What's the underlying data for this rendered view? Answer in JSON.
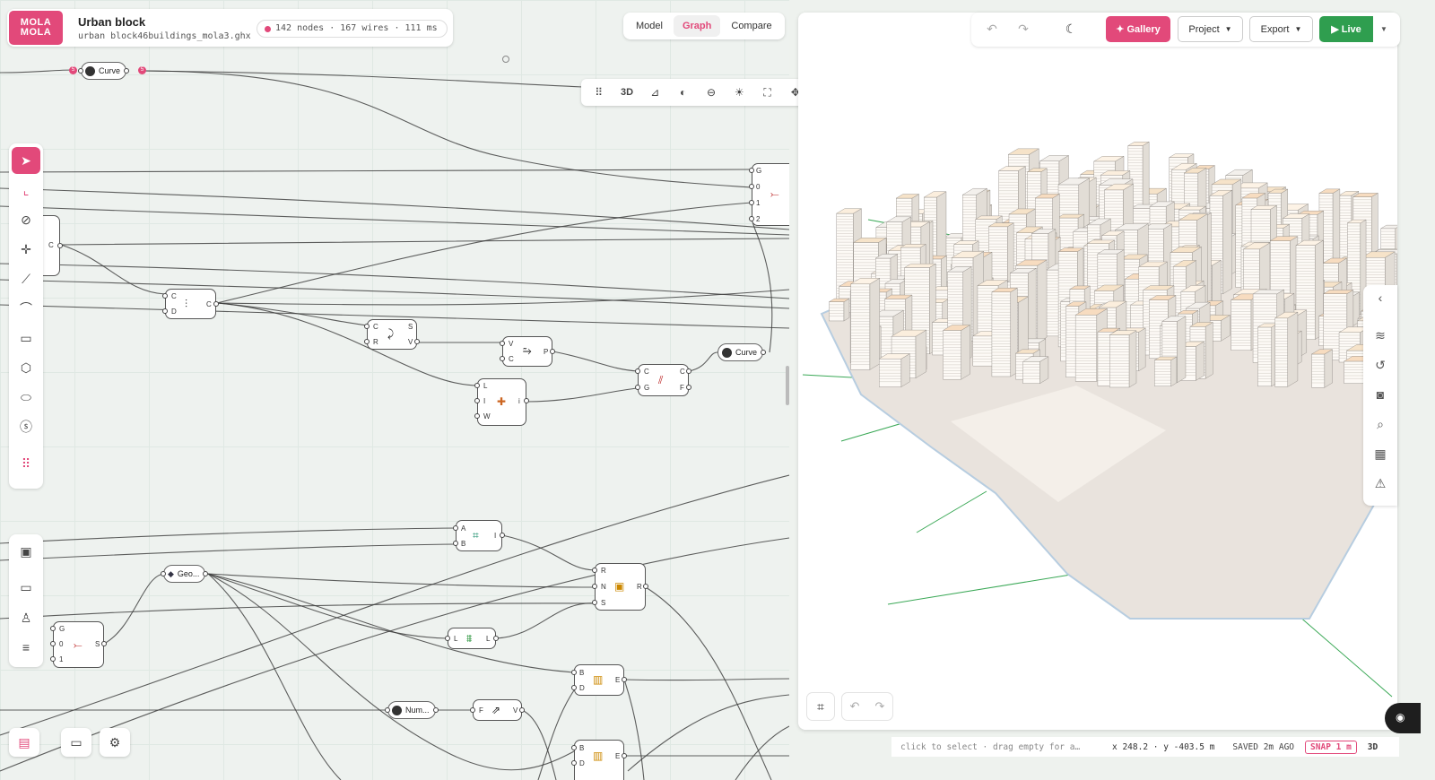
{
  "header": {
    "logo_text": "MOLA MOLA",
    "title": "Urban block",
    "file_name": "urban block46buildings_mola3.ghx",
    "stats": "142 nodes · 167 wires · 111 ms"
  },
  "view_tabs": [
    {
      "label": "Model",
      "active": false
    },
    {
      "label": "Graph",
      "active": true
    },
    {
      "label": "Compare",
      "active": false
    }
  ],
  "view_toolbar": {
    "items": [
      "drag-handle-icon",
      "3D",
      "ortho-icon",
      "contrast-icon",
      "ground-icon",
      "sun-icon",
      "fit-view-icon",
      "move-icon",
      "settings-sliders-icon"
    ],
    "mode_label": "3D"
  },
  "top_actions": {
    "gallery": "✦ Gallery",
    "project": "Project",
    "export": "Export",
    "live": "▶ Live"
  },
  "tools": [
    "select-arrow-icon",
    "stairs-icon",
    "curve-tool-icon",
    "point-icon",
    "polyline-icon",
    "bezier-icon",
    "rectangle-icon",
    "hexagon-icon",
    "ellipse-icon",
    "spiral-icon",
    "grid-dots-icon"
  ],
  "tools2": [
    "image-icon",
    "folder-icon",
    "user-icon",
    "menu-icon"
  ],
  "nodes": {
    "curve_top": {
      "label": "Curve",
      "badge": "5"
    },
    "curve_right": {
      "label": "Curve"
    },
    "geo": {
      "label": "Geo..."
    },
    "num": {
      "label": "Num..."
    }
  },
  "status": {
    "hint": "click to select · drag empty for a…",
    "coords": "x 248.2 · y -403.5 m",
    "saved": "SAVED 2m AGO",
    "snap": "SNAP 1 m",
    "mode": "3D"
  },
  "accent_color": "#e2497a",
  "live_color": "#2f9e4f"
}
